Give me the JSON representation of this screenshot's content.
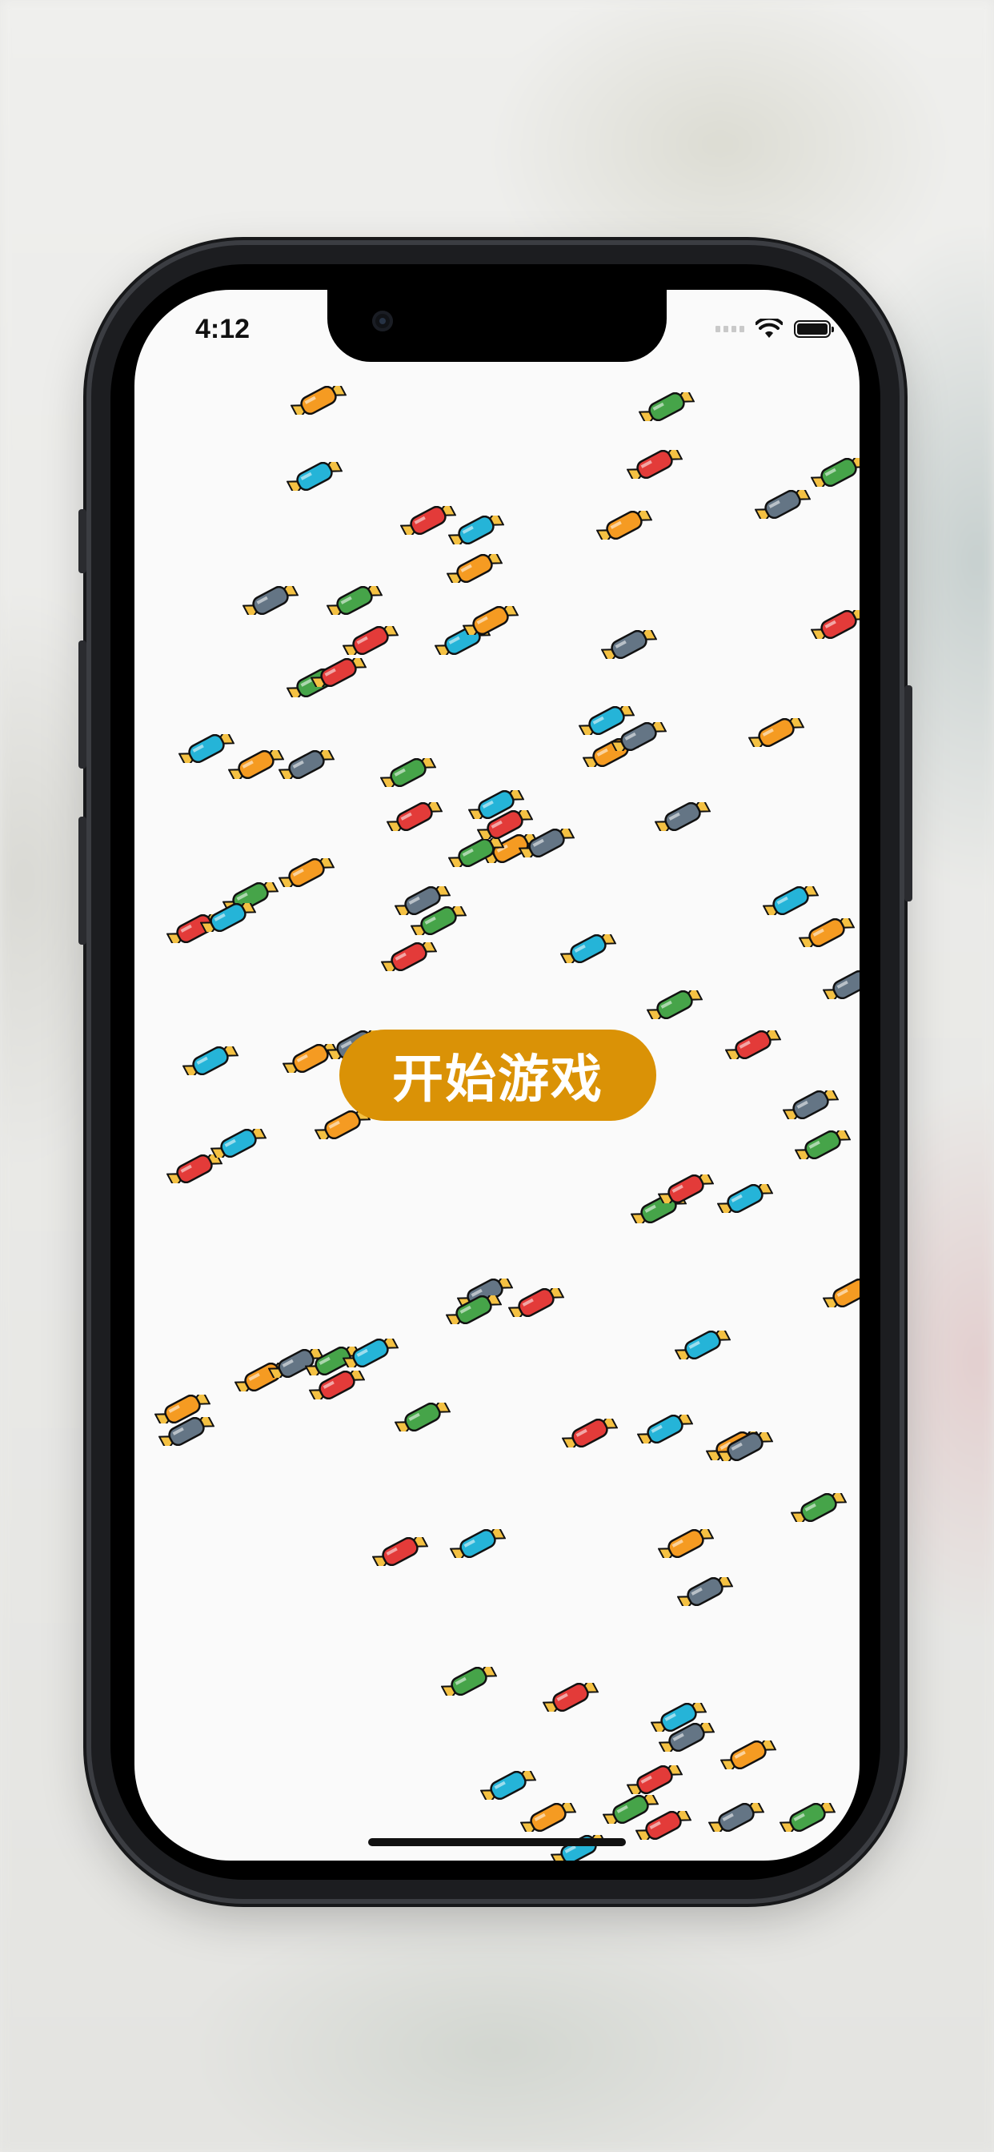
{
  "status_bar": {
    "time": "4:12",
    "icons": [
      "cellular-signal-icon",
      "wifi-icon",
      "battery-icon"
    ]
  },
  "game": {
    "start_button_label": "开始游戏",
    "accent_color": "#da9206",
    "candy_colors": {
      "orange": "#f59b22",
      "gray": "#647585",
      "green": "#46a449",
      "red": "#e33b39",
      "cyan": "#25b4d8"
    },
    "candy_wrapper_color": "#f4c143"
  }
}
